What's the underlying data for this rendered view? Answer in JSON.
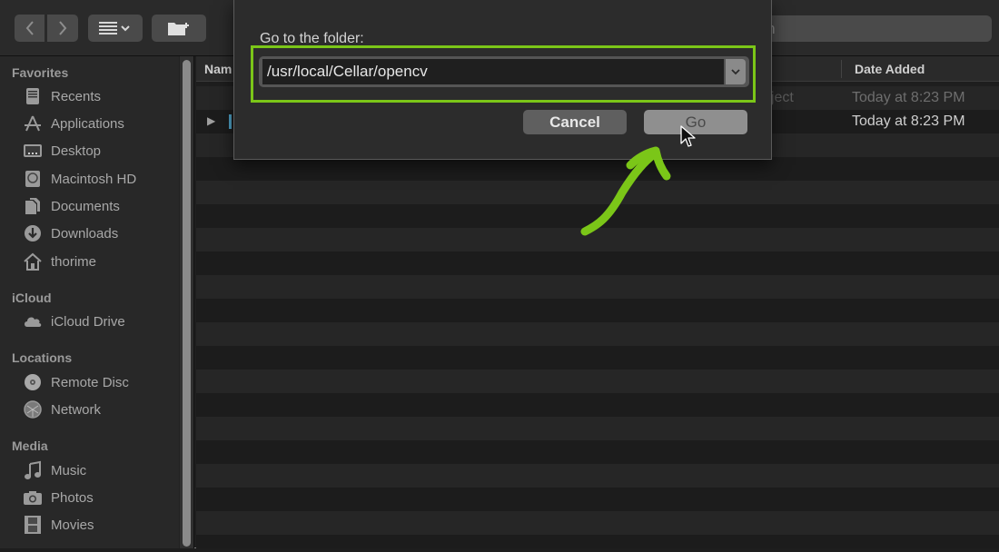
{
  "toolbar": {
    "back_icon": "chevron-left-icon",
    "forward_icon": "chevron-right-icon",
    "view_icon": "list-view-icon",
    "new_folder_icon": "new-folder-icon",
    "search_placeholder": "Search",
    "search_visible_text": "rch"
  },
  "sidebar": {
    "sections": [
      {
        "header": "Favorites",
        "items": [
          {
            "label": "Recents",
            "icon": "recents-icon"
          },
          {
            "label": "Applications",
            "icon": "applications-icon"
          },
          {
            "label": "Desktop",
            "icon": "desktop-icon"
          },
          {
            "label": "Macintosh HD",
            "icon": "hard-drive-icon"
          },
          {
            "label": "Documents",
            "icon": "documents-icon"
          },
          {
            "label": "Downloads",
            "icon": "downloads-icon"
          },
          {
            "label": "thorime",
            "icon": "home-icon"
          }
        ]
      },
      {
        "header": "iCloud",
        "items": [
          {
            "label": "iCloud Drive",
            "icon": "cloud-icon"
          }
        ]
      },
      {
        "header": "Locations",
        "items": [
          {
            "label": "Remote Disc",
            "icon": "disc-icon"
          },
          {
            "label": "Network",
            "icon": "network-icon"
          }
        ]
      },
      {
        "header": "Media",
        "items": [
          {
            "label": "Music",
            "icon": "music-icon"
          },
          {
            "label": "Photos",
            "icon": "camera-icon"
          },
          {
            "label": "Movies",
            "icon": "film-icon"
          }
        ]
      }
    ]
  },
  "list": {
    "columns": {
      "name": "Nam",
      "date_added": "Date Added"
    },
    "rows": [
      {
        "kind": "oject",
        "date_added": "Today at 8:23 PM",
        "selected": false
      },
      {
        "kind": "",
        "date_added": "Today at 8:23 PM",
        "selected": true
      }
    ]
  },
  "dialog": {
    "label": "Go to the folder:",
    "path_value": "/usr/local/Cellar/opencv",
    "cancel_label": "Cancel",
    "go_label": "Go"
  },
  "annotation": {
    "highlight_color": "#7bc618",
    "arrow_color": "#7bc618"
  }
}
